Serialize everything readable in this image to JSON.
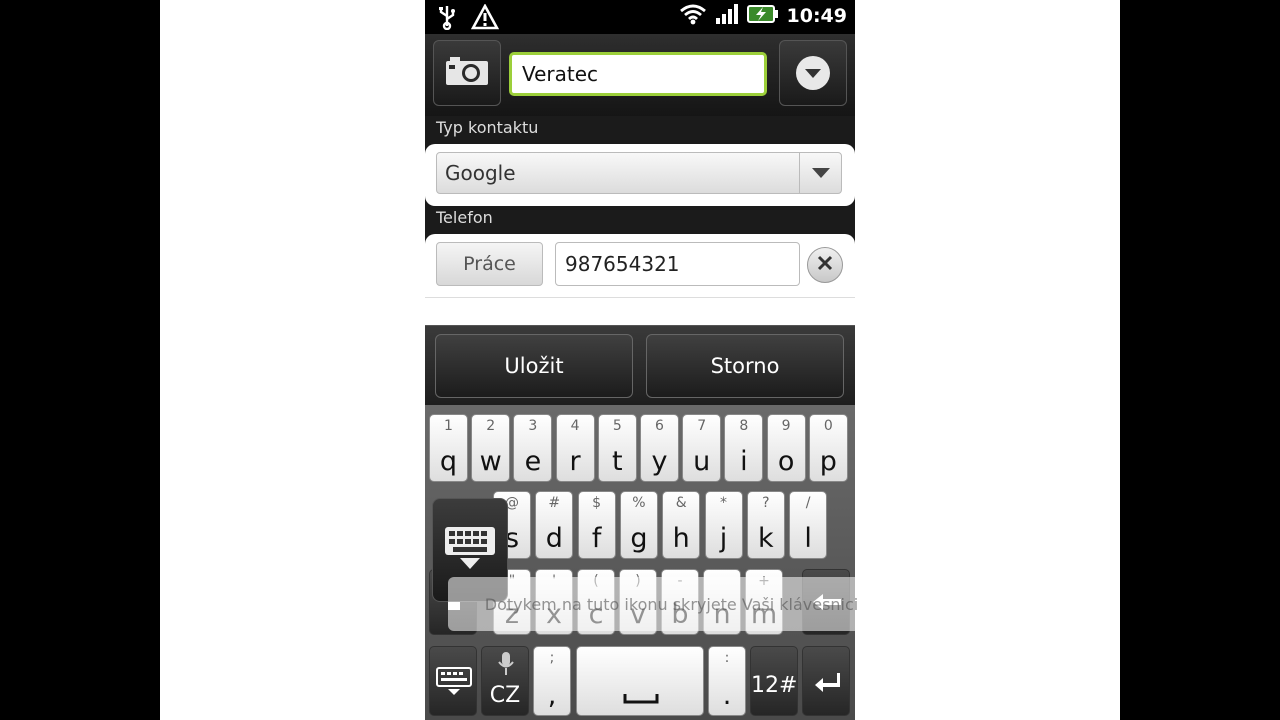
{
  "status": {
    "time": "10:49"
  },
  "contact": {
    "name": "Veratec"
  },
  "type_section": {
    "label": "Typ kontaktu",
    "value": "Google"
  },
  "phone_section": {
    "label": "Telefon",
    "type": "Práce",
    "number": "987654321"
  },
  "actions": {
    "save": "Uložit",
    "cancel": "Storno"
  },
  "keyboard": {
    "row1": [
      {
        "sec": "1",
        "pri": "q"
      },
      {
        "sec": "2",
        "pri": "w"
      },
      {
        "sec": "3",
        "pri": "e"
      },
      {
        "sec": "4",
        "pri": "r"
      },
      {
        "sec": "5",
        "pri": "t"
      },
      {
        "sec": "6",
        "pri": "y"
      },
      {
        "sec": "7",
        "pri": "u"
      },
      {
        "sec": "8",
        "pri": "i"
      },
      {
        "sec": "9",
        "pri": "o"
      },
      {
        "sec": "0",
        "pri": "p"
      }
    ],
    "row2": [
      {
        "sec": "@",
        "pri": "s"
      },
      {
        "sec": "#",
        "pri": "d"
      },
      {
        "sec": "$",
        "pri": "f"
      },
      {
        "sec": "%",
        "pri": "g"
      },
      {
        "sec": "&",
        "pri": "h"
      },
      {
        "sec": "*",
        "pri": "j"
      },
      {
        "sec": "?",
        "pri": "k"
      },
      {
        "sec": "/",
        "pri": "l"
      }
    ],
    "row3": [
      {
        "sec": "\"",
        "pri": "z"
      },
      {
        "sec": "'",
        "pri": "x"
      },
      {
        "sec": "(",
        "pri": "c"
      },
      {
        "sec": ")",
        "pri": "v"
      },
      {
        "sec": "-",
        "pri": "b"
      },
      {
        "sec": "",
        "pri": "n"
      },
      {
        "sec": "+",
        "pri": "m"
      }
    ],
    "lang": "CZ",
    "semicolon_sec": ";",
    "comma": ",",
    "colon_sec": ":",
    "period": ".",
    "numbers": "12#"
  },
  "toast": {
    "text": "Dotykem na tuto ikonu skryjete Vaši klávesnici"
  }
}
